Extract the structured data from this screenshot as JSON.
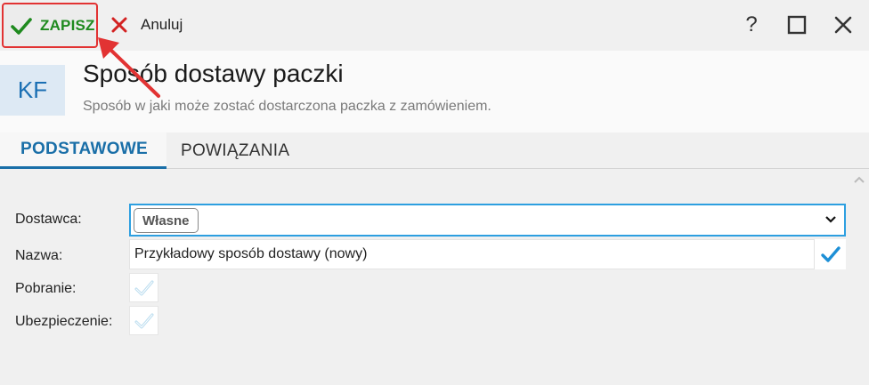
{
  "toolbar": {
    "save_label": "ZAPISZ",
    "cancel_label": "Anuluj",
    "help_label": "?"
  },
  "header": {
    "badge": "KF",
    "title": "Sposób dostawy paczki",
    "subtitle": "Sposób w jaki może zostać dostarczona paczka z zamówieniem."
  },
  "tabs": [
    {
      "label": "PODSTAWOWE",
      "active": true
    },
    {
      "label": "POWIĄZANIA",
      "active": false
    }
  ],
  "form": {
    "dostawca": {
      "label": "Dostawca:",
      "value": "Własne"
    },
    "nazwa": {
      "label": "Nazwa:",
      "value": "Przykładowy sposób dostawy (nowy)"
    },
    "pobranie": {
      "label": "Pobranie:",
      "checked": false
    },
    "ubezpieczenie": {
      "label": "Ubezpieczenie:",
      "checked": false
    }
  },
  "colors": {
    "save_green": "#1f8a1f",
    "highlight_red": "#e23333",
    "accent_blue": "#1a6fa8",
    "focus_blue": "#2d9fe0"
  }
}
